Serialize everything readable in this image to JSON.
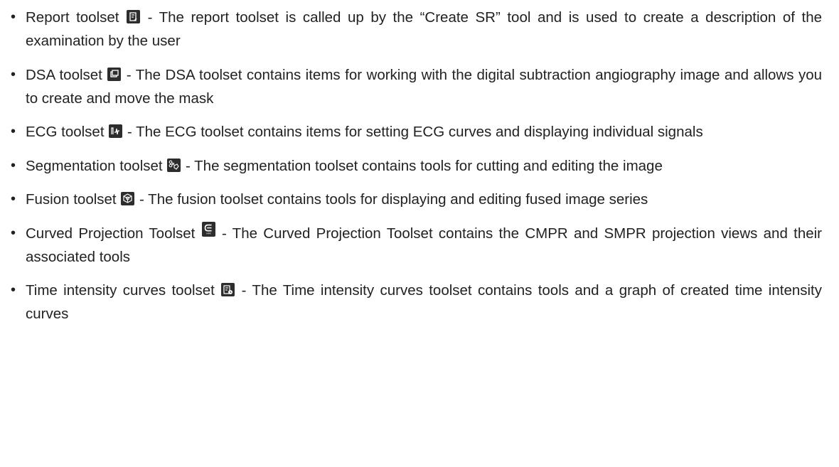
{
  "items": [
    {
      "name": "Report toolset",
      "icon": "report-icon",
      "description": " - The report toolset is called up by the “Create SR” tool and is used to create a description of the examination by the user"
    },
    {
      "name": "DSA toolset",
      "icon": "dsa-icon",
      "description": " - The DSA toolset contains items for working with the digital subtraction angiography image and allows you to create and move the mask"
    },
    {
      "name": "ECG toolset",
      "icon": "ecg-icon",
      "description": " - The ECG toolset contains items for setting ECG curves and displaying individual signals"
    },
    {
      "name": "Segmentation toolset",
      "icon": "segmentation-icon",
      "description": " - The segmentation toolset contains tools for cutting and editing the image"
    },
    {
      "name": "Fusion toolset",
      "icon": "fusion-icon",
      "description": " - The fusion toolset contains tools for displaying and editing fused image series"
    },
    {
      "name": "Curved Projection Toolset",
      "icon": "curved-projection-icon",
      "description": " - The Curved Projection Toolset contains the CMPR and SMPR projection views and their associated tools"
    },
    {
      "name": "Time intensity curves toolset",
      "icon": "time-intensity-curves-icon",
      "description": " - The Time intensity curves toolset contains tools and a graph of created time intensity curves"
    }
  ]
}
